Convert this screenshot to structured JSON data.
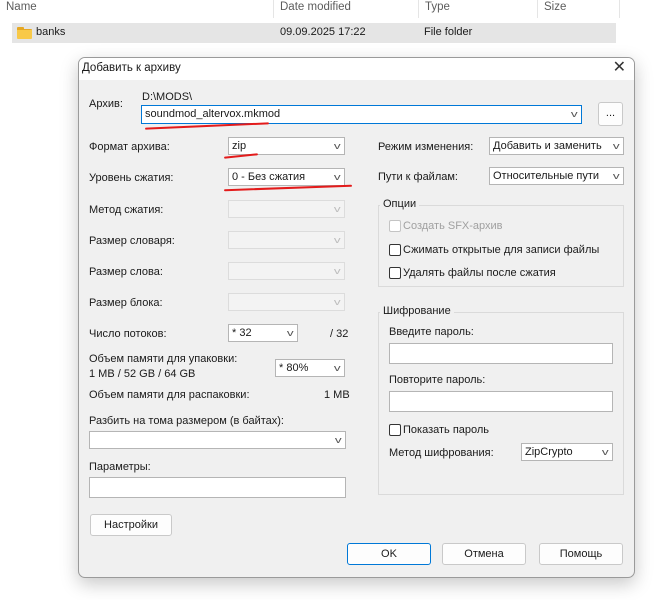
{
  "explorer": {
    "columns": [
      "Name",
      "Date modified",
      "Type",
      "Size"
    ],
    "row": {
      "name": "banks",
      "date": "09.09.2025 17:22",
      "type": "File folder"
    }
  },
  "dialog": {
    "title": "Добавить к архиву",
    "close_glyph": "✕",
    "archive_label": "Архив:",
    "archive_dir": "D:\\MODS\\",
    "archive_name": "soundmod_altervox.mkmod",
    "browse_label": "...",
    "left": {
      "format_label": "Формат архива:",
      "format_value": "zip",
      "level_label": "Уровень сжатия:",
      "level_value": "0 - Без сжатия",
      "method_label": "Метод сжатия:",
      "dict_label": "Размер словаря:",
      "word_label": "Размер слова:",
      "block_label": "Размер блока:",
      "threads_label": "Число потоков:",
      "threads_value": "* 32",
      "threads_max": "/ 32",
      "mem_label": "Объем памяти для упаковки:",
      "mem_info": "1 MB / 52 GB / 64 GB",
      "mem_value": "* 80%",
      "unpack_label": "Объем памяти для распаковки:",
      "unpack_value": "1 MB",
      "split_label": "Разбить на тома размером (в байтах):",
      "params_label": "Параметры:",
      "settings_btn": "Настройки"
    },
    "right": {
      "mode_label": "Режим изменения:",
      "mode_value": "Добавить и заменить",
      "paths_label": "Пути к файлам:",
      "paths_value": "Относительные пути",
      "options_title": "Опции",
      "opt_sfx": "Создать SFX-архив",
      "opt_shared": "Сжимать открытые для записи файлы",
      "opt_delete": "Удалять файлы после сжатия",
      "enc_title": "Шифрование",
      "enc_pwd_label": "Введите пароль:",
      "enc_repeat_label": "Повторите пароль:",
      "enc_show_label": "Показать пароль",
      "enc_method_label": "Метод шифрования:",
      "enc_method_value": "ZipCrypto"
    },
    "buttons": {
      "ok": "OK",
      "cancel": "Отмена",
      "help": "Помощь"
    }
  },
  "colors": {
    "accent": "#0078d7",
    "annotation_red": "#e31b1b",
    "dialog_bg": "#f0f0f0",
    "folder_yellow": "#f8c948"
  }
}
